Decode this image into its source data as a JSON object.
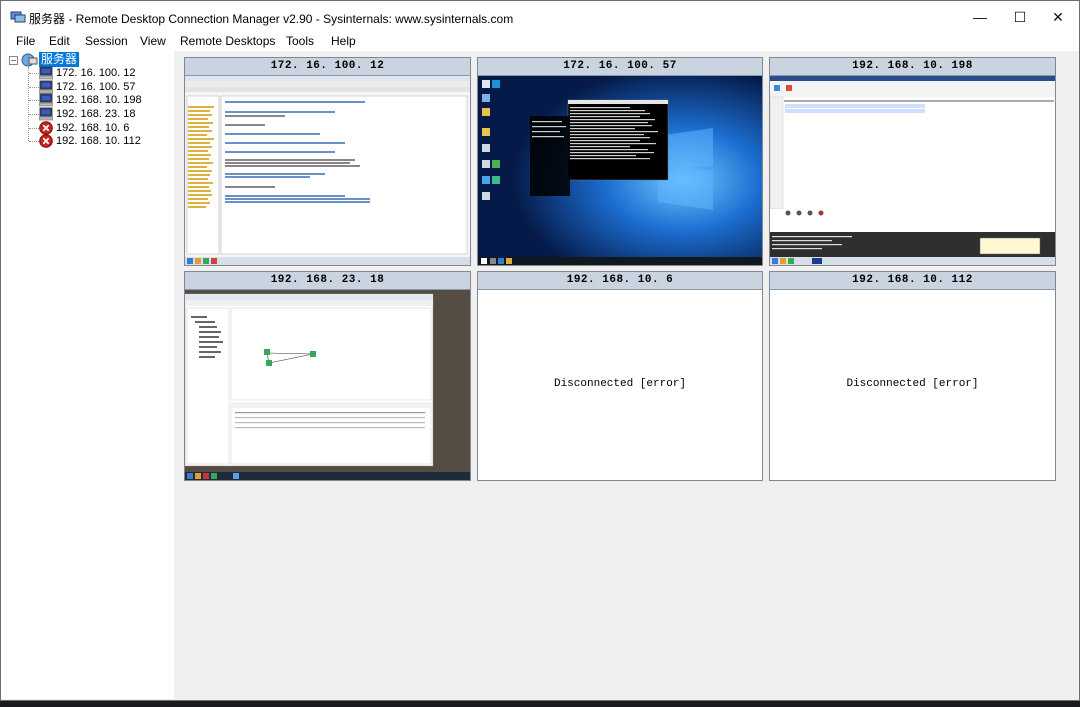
{
  "window": {
    "title": "服务器 - Remote Desktop Connection Manager v2.90 - Sysinternals: www.sysinternals.com",
    "controls": {
      "minimize": "—",
      "maximize": "☐",
      "close": "✕"
    }
  },
  "menu": [
    "File",
    "Edit",
    "Session",
    "View",
    "Remote Desktops",
    "Tools",
    "Help"
  ],
  "tree": {
    "expander": "−",
    "root": "服务器",
    "servers": [
      {
        "label": "172. 16. 100. 12",
        "status": "connected"
      },
      {
        "label": "172. 16. 100. 57",
        "status": "connected"
      },
      {
        "label": "192. 168. 10. 198",
        "status": "connected"
      },
      {
        "label": "192. 168. 23. 18",
        "status": "connected"
      },
      {
        "label": "192. 168. 10. 6",
        "status": "error"
      },
      {
        "label": "192. 168. 10. 112",
        "status": "error"
      }
    ]
  },
  "panes": [
    {
      "title": "172. 16. 100. 12",
      "state": "connected"
    },
    {
      "title": "172. 16. 100. 57",
      "state": "connected"
    },
    {
      "title": "192. 168. 10. 198",
      "state": "connected"
    },
    {
      "title": "192. 168. 23. 18",
      "state": "connected"
    },
    {
      "title": "192. 168. 10. 6",
      "state": "disconnected",
      "message": "Disconnected [error]"
    },
    {
      "title": "192. 168. 10. 112",
      "state": "disconnected",
      "message": "Disconnected [error]"
    }
  ],
  "colors": {
    "selection": "#0078d7",
    "pane_header": "#c9d4e0",
    "win10_desktop": "#0a3a7a",
    "error_icon": "#c8201e"
  }
}
